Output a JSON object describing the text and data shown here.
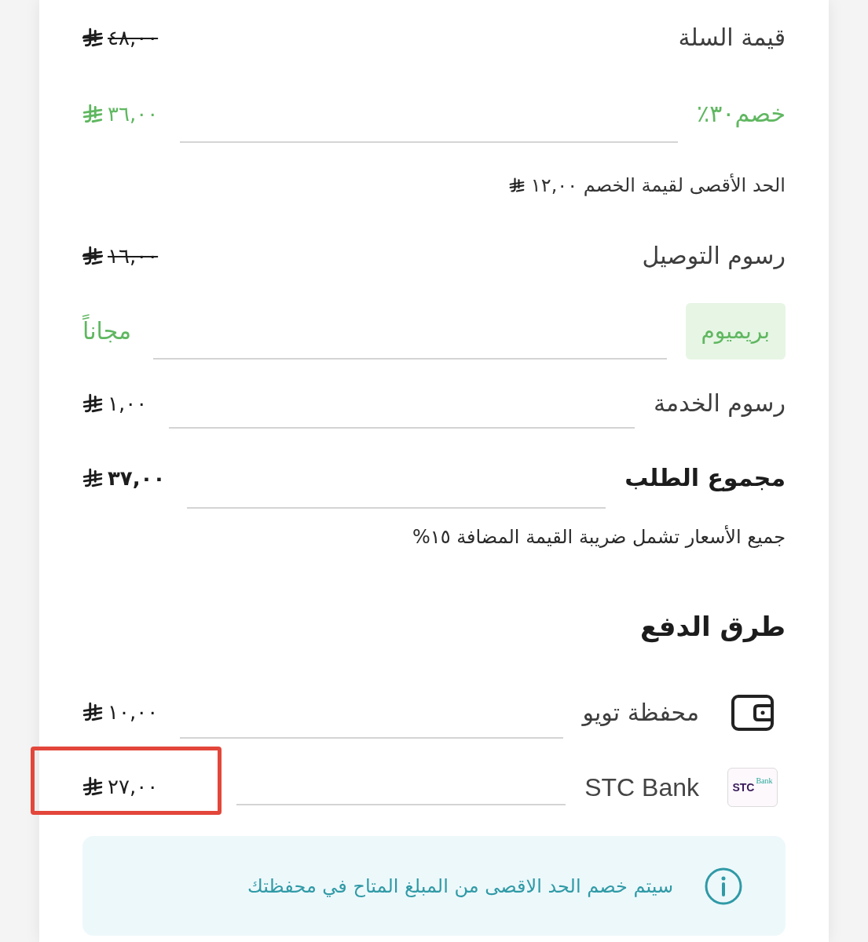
{
  "summary": {
    "rows": [
      {
        "kind": "line",
        "label": "قيمة السلة",
        "amount": "٤٨,٠٠",
        "struck": true,
        "separator": false
      },
      {
        "kind": "discount",
        "label": "خصم٣٠٪",
        "amount": "٣٦,٠٠",
        "separator": true
      },
      {
        "kind": "note",
        "text": "الحد الأقصى لقيمة الخصم ١٢,٠٠"
      },
      {
        "kind": "line",
        "label": "رسوم التوصيل",
        "amount": "١٦,٠٠",
        "struck": true,
        "separator": false
      },
      {
        "kind": "badge",
        "badge": "بريميوم",
        "value": "مجاناً",
        "separator": true
      },
      {
        "kind": "line",
        "label": "رسوم الخدمة",
        "amount": "١,٠٠",
        "struck": false,
        "separator": true
      },
      {
        "kind": "total",
        "label": "مجموع الطلب",
        "amount": "٣٧,٠٠",
        "separator": true
      },
      {
        "kind": "footnote",
        "text": "جميع الأسعار تشمل ضريبة القيمة المضافة ١٥%"
      }
    ]
  },
  "payment": {
    "title": "طرق الدفع",
    "methods": [
      {
        "kind": "wallet",
        "name": "محفظة تويو",
        "amount": "١٠,٠٠",
        "highlighted": false
      },
      {
        "kind": "bank",
        "name": "STC Bank",
        "logo": {
          "brand": "STC",
          "sub": "Bank"
        },
        "amount": "٢٧,٠٠",
        "highlighted": true
      }
    ],
    "notice": "سيتم خصم الحد الاقصى من المبلغ المتاح في محفظتك"
  }
}
